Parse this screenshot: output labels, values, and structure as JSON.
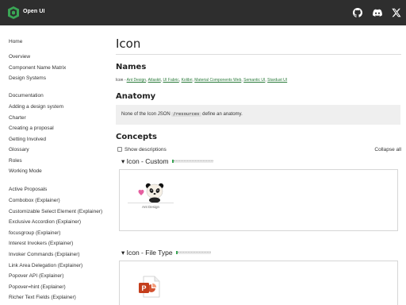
{
  "header": {
    "brand": "Open UI",
    "logo_icon": "open-ui-logo-icon",
    "icons": [
      "github-icon",
      "discord-icon",
      "x-twitter-icon"
    ],
    "background": "#2e2e2e"
  },
  "sidebar": {
    "items": [
      "Home",
      "Overview",
      "Component Name Matrix",
      "Design Systems",
      "Documentation",
      "Adding a design system",
      "Charter",
      "Creating a proposal",
      "Getting Involved",
      "Glossary",
      "Roles",
      "Working Mode",
      "Active Proposals",
      "Combobox (Explainer)",
      "Customizable Select Element (Explainer)",
      "Exclusive Accordion (Explainer)",
      "focusgroup (Explainer)",
      "Interest Invokers (Explainer)",
      "Invoker Commands (Explainer)",
      "Link Area Delegation (Explainer)",
      "Popover API (Explainer)",
      "Popover=hint (Explainer)",
      "Richer Text Fields (Explainer)"
    ]
  },
  "main": {
    "title": "Icon",
    "names": {
      "heading": "Names",
      "prefix": "Icon - ",
      "systems": [
        "Ant Design",
        "Atlaskit",
        "UI Fabric",
        "Kolibri",
        "Material Components Web",
        "Semantic UI",
        "Stardust UI"
      ]
    },
    "anatomy": {
      "heading": "Anatomy",
      "text_before": "None of the Icon JSON ",
      "code": "/resources",
      "text_after": " define an anatomy."
    },
    "concepts": {
      "heading": "Concepts",
      "show_descriptions": "Show descriptions",
      "collapse_all": "Collapse all",
      "items": [
        {
          "title": "▾ Icon - Custom",
          "example_label": "Ant Design",
          "example_icon": "panda-heart-icon"
        },
        {
          "title": "▾ Icon - File Type",
          "example_icon": "powerpoint-file-icon"
        }
      ]
    }
  },
  "colors": {
    "link": "#2a7a3a",
    "accent": "#3aa655"
  }
}
